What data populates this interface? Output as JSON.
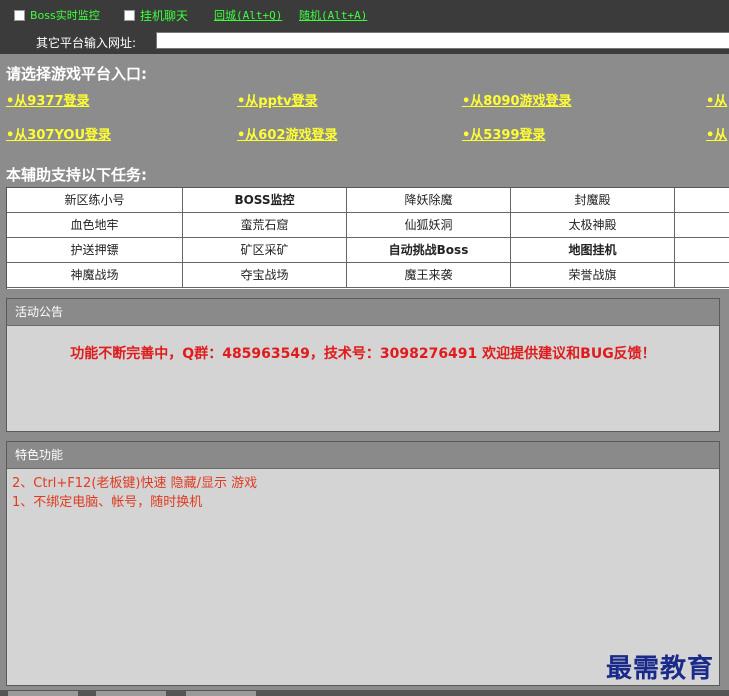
{
  "topbar": {
    "boss_monitor_label": "Boss实时监控",
    "idle_chat_label": "挂机聊天",
    "return_city_link": "回城(Alt+Q)",
    "random_link": "随机(Alt+A)"
  },
  "urlbar": {
    "label": "其它平台输入网址:",
    "value": ""
  },
  "platforms": {
    "title": "请选择游戏平台入口:",
    "items": [
      "•从9377登录",
      "•从pptv登录",
      "•从8090游戏登录",
      "•从",
      "•从307YOU登录",
      "•从602游戏登录",
      "•从5399登录",
      "•从"
    ]
  },
  "tasks": {
    "title": "本辅助支持以下任务:",
    "rows": [
      [
        "新区练小号",
        "BOSS监控",
        "降妖除魔",
        "封魔殿",
        ""
      ],
      [
        "血色地牢",
        "蛮荒石窟",
        "仙狐妖洞",
        "太极神殿",
        ""
      ],
      [
        "护送押镖",
        "矿区采矿",
        "自动挑战Boss",
        "地图挂机",
        ""
      ],
      [
        "神魔战场",
        "夺宝战场",
        "魔王来袭",
        "荣誉战旗",
        ""
      ]
    ]
  },
  "announcement": {
    "header": "活动公告",
    "text": "功能不断完善中，Q群：485963549，技术号：3098276491 欢迎提供建议和BUG反馈！"
  },
  "features": {
    "header": "特色功能",
    "lines": [
      "2、Ctrl+F12(老板键)快速 隐藏/显示 游戏",
      "1、不绑定电脑、帐号，随时换机"
    ]
  },
  "watermark": "最需教育",
  "colors": {
    "link_green": "#3cff3c",
    "platform_yellow": "#ffff33",
    "notice_red": "#e01b1b"
  }
}
